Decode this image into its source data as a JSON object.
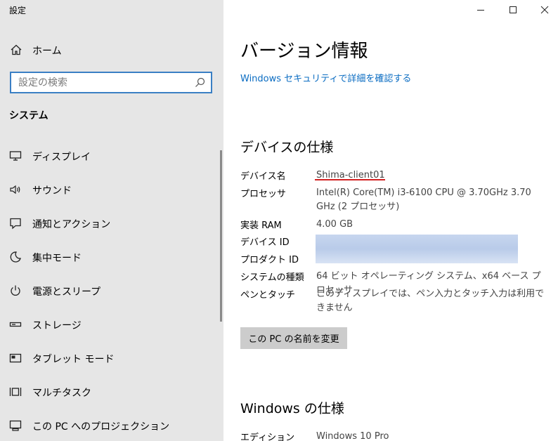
{
  "app": {
    "title": "設定"
  },
  "sidebar": {
    "home_label": "ホーム",
    "search": {
      "placeholder": "設定の検索",
      "value": ""
    },
    "section_title": "システム",
    "items": [
      {
        "label": "ディスプレイ",
        "icon": "display-icon"
      },
      {
        "label": "サウンド",
        "icon": "speaker-icon"
      },
      {
        "label": "通知とアクション",
        "icon": "notification-icon"
      },
      {
        "label": "集中モード",
        "icon": "moon-icon"
      },
      {
        "label": "電源とスリープ",
        "icon": "power-icon"
      },
      {
        "label": "ストレージ",
        "icon": "storage-icon"
      },
      {
        "label": "タブレット モード",
        "icon": "tablet-icon"
      },
      {
        "label": "マルチタスク",
        "icon": "multitask-icon"
      },
      {
        "label": "この PC へのプロジェクション",
        "icon": "projection-icon"
      }
    ]
  },
  "window_controls": {
    "icons": [
      "minimize-icon",
      "maximize-icon",
      "close-icon"
    ]
  },
  "main": {
    "title": "バージョン情報",
    "security_link": "Windows セキュリティで詳細を確認する",
    "device_specs": {
      "heading": "デバイスの仕様",
      "rows": [
        {
          "key": "デバイス名",
          "value": "Shima-client01"
        },
        {
          "key": "プロセッサ",
          "value": "Intel(R) Core(TM) i3-6100 CPU @ 3.70GHz   3.70 GHz  (2 プロセッサ)"
        },
        {
          "key": "実装 RAM",
          "value": "4.00 GB"
        },
        {
          "key": "デバイス ID",
          "value": ""
        },
        {
          "key": "プロダクト ID",
          "value": ""
        },
        {
          "key": "システムの種類",
          "value": "64 ビット オペレーティング システム、x64 ベース プロセッサ"
        },
        {
          "key": "ペンとタッチ",
          "value": "このディスプレイでは、ペン入力とタッチ入力は利用できません"
        }
      ],
      "rename_button": "この PC の名前を変更"
    },
    "windows_specs": {
      "heading": "Windows の仕様",
      "rows": [
        {
          "key": "エディション",
          "value": "Windows 10 Pro"
        }
      ]
    }
  },
  "colors": {
    "accent": "#0a6cc2",
    "sidebar_bg": "#e6e6e6",
    "highlight": "#d22020"
  }
}
